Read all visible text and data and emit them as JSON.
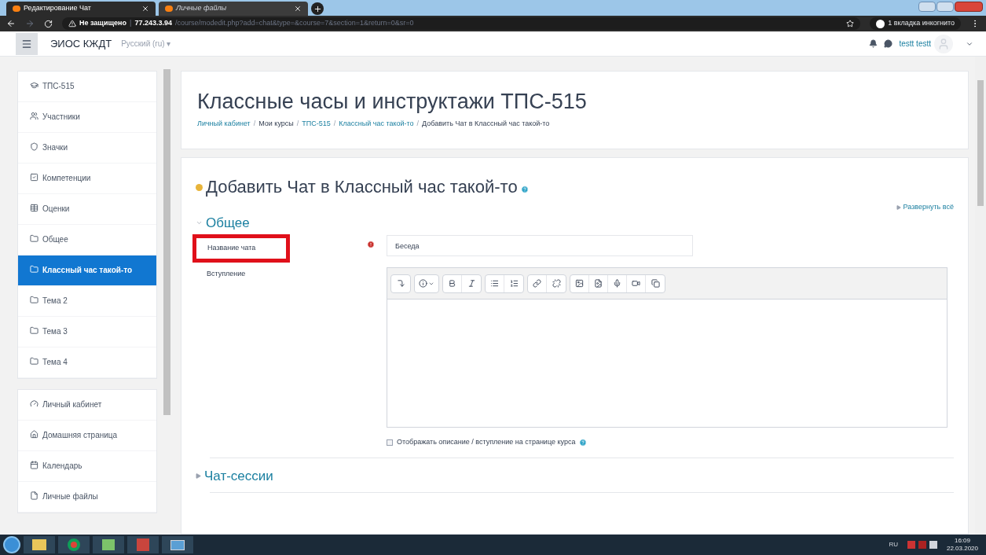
{
  "browser": {
    "tabs": [
      {
        "title": "Редактирование Чат",
        "selected": true
      },
      {
        "title": "Личные файлы",
        "selected": false
      }
    ],
    "security": "Не защищено",
    "url_separator": "|",
    "url_host": "77.243.3.94",
    "url_path": "/course/modedit.php?add=chat&type=&course=7&section=1&return=0&sr=0",
    "incognito": "1 вкладка инкогнито"
  },
  "navbar": {
    "site": "ЭИОС КЖДТ",
    "language": "Русский (ru) ▾",
    "user": "testt testt"
  },
  "sidebar": {
    "groups": [
      [
        {
          "label": "ТПС-515",
          "kind": "course",
          "selected": false
        },
        {
          "label": "Участники",
          "kind": "users",
          "selected": false
        },
        {
          "label": "Значки",
          "kind": "shield",
          "selected": false
        },
        {
          "label": "Компетенции",
          "kind": "check",
          "selected": false
        },
        {
          "label": "Оценки",
          "kind": "table",
          "selected": false
        },
        {
          "label": "Общее",
          "kind": "folder",
          "selected": false
        },
        {
          "label": "Классный час такой-то",
          "kind": "folder",
          "selected": true
        },
        {
          "label": "Тема 2",
          "kind": "folder",
          "selected": false
        },
        {
          "label": "Тема 3",
          "kind": "folder",
          "selected": false
        },
        {
          "label": "Тема 4",
          "kind": "folder",
          "selected": false
        }
      ],
      [
        {
          "label": "Личный кабинет",
          "kind": "gauge",
          "selected": false
        },
        {
          "label": "Домашняя страница",
          "kind": "home",
          "selected": false
        },
        {
          "label": "Календарь",
          "kind": "calendar",
          "selected": false
        },
        {
          "label": "Личные файлы",
          "kind": "file",
          "selected": false
        }
      ]
    ]
  },
  "header": {
    "title": "Классные часы и инструктажи ТПС-515",
    "separator": "/",
    "breadcrumb": [
      {
        "label": "Личный кабинет",
        "link": true
      },
      {
        "label": "Мои курсы",
        "link": false
      },
      {
        "label": "ТПС-515",
        "link": true
      },
      {
        "label": "Классный час такой-то",
        "link": true
      },
      {
        "label": "Добавить Чат в Классный час такой-то",
        "link": false
      }
    ]
  },
  "form": {
    "title": "Добавить Чат в Классный час такой-то",
    "expand_all": "Развернуть всё",
    "sections": [
      {
        "title": "Общее",
        "expanded": true
      },
      {
        "title": "Чат-сессии",
        "expanded": false
      }
    ],
    "name_field": {
      "label": "Название чата",
      "value": "Беседа",
      "required": true,
      "highlighted": true
    },
    "intro_field": {
      "label": "Вступление"
    },
    "show_description": {
      "label": "Отображать описание / вступление на странице курса",
      "checked": false
    }
  },
  "taskbar": {
    "language": "RU",
    "time": "16:09",
    "date": "22.03.2020"
  }
}
